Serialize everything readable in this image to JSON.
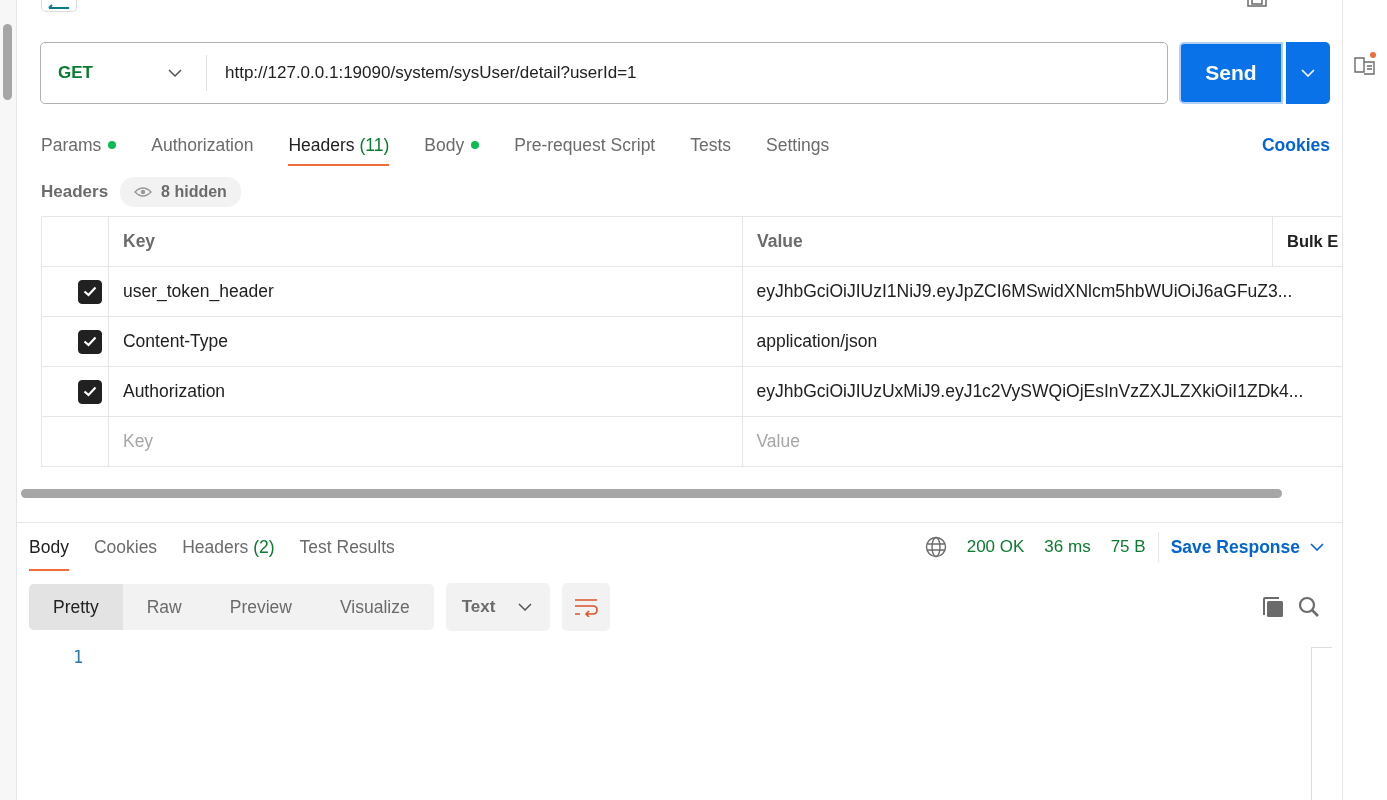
{
  "request": {
    "method": "GET",
    "url": "http://127.0.0.1:19090/system/sysUser/detail?userId=1",
    "send_label": "Send"
  },
  "request_tabs": [
    {
      "label": "Params",
      "selected": false,
      "dot": true
    },
    {
      "label": "Authorization",
      "selected": false,
      "dot": false
    },
    {
      "label": "Headers",
      "count": "(11)",
      "selected": true,
      "dot": false
    },
    {
      "label": "Body",
      "selected": false,
      "dot": true
    },
    {
      "label": "Pre-request Script",
      "selected": false,
      "dot": false
    },
    {
      "label": "Tests",
      "selected": false,
      "dot": false
    },
    {
      "label": "Settings",
      "selected": false,
      "dot": false
    }
  ],
  "cookies_link": "Cookies",
  "headers_section": {
    "title": "Headers",
    "hidden_badge": "8 hidden"
  },
  "headers_table": {
    "columns": [
      "Key",
      "Value",
      "Bulk E"
    ],
    "rows": [
      {
        "checked": true,
        "key": "user_token_header",
        "value": "eyJhbGciOiJIUzI1NiJ9.eyJpZCI6MSwidXNlcm5hbWUiOiJ6aGFuZ3..."
      },
      {
        "checked": true,
        "key": "Content-Type",
        "value": "application/json"
      },
      {
        "checked": true,
        "key": "Authorization",
        "value": "eyJhbGciOiJIUzUxMiJ9.eyJ1c2VySWQiOjEsInVzZXJLZXkiOiI1ZDk4..."
      }
    ],
    "new_row": {
      "key_placeholder": "Key",
      "value_placeholder": "Value"
    }
  },
  "response_tabs": [
    {
      "label": "Body",
      "selected": true
    },
    {
      "label": "Cookies",
      "selected": false
    },
    {
      "label": "Headers",
      "count": "(2)",
      "selected": false
    },
    {
      "label": "Test Results",
      "selected": false
    }
  ],
  "response_status": {
    "status": "200 OK",
    "time": "36 ms",
    "size": "75 B",
    "save_label": "Save Response"
  },
  "view_modes": [
    {
      "label": "Pretty",
      "selected": true
    },
    {
      "label": "Raw",
      "selected": false
    },
    {
      "label": "Preview",
      "selected": false
    },
    {
      "label": "Visualize",
      "selected": false
    }
  ],
  "format": "Text",
  "editor": {
    "line_numbers": [
      "1"
    ]
  }
}
